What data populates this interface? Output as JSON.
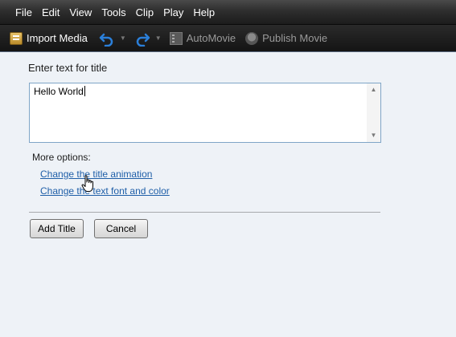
{
  "menu": {
    "items": [
      "File",
      "Edit",
      "View",
      "Tools",
      "Clip",
      "Play",
      "Help"
    ]
  },
  "toolbar": {
    "import_media": "Import Media",
    "automovie": "AutoMovie",
    "publish_movie": "Publish Movie"
  },
  "title_panel": {
    "prompt": "Enter text for title",
    "text_value": "Hello World",
    "more_options_label": "More options:",
    "link_animation": "Change the title animation",
    "link_font": "Change the text font and color",
    "add_button": "Add Title",
    "cancel_button": "Cancel"
  },
  "icons": {
    "import": "import-media-icon",
    "undo": "undo-icon",
    "redo": "redo-icon",
    "automovie": "automovie-icon",
    "publish": "publish-movie-icon",
    "cursor": "hand-cursor-icon"
  },
  "colors": {
    "link": "#1f5fa8",
    "background": "#eef2f7",
    "toolbar_dark": "#141414",
    "undo_blue": "#2b7fd9"
  }
}
